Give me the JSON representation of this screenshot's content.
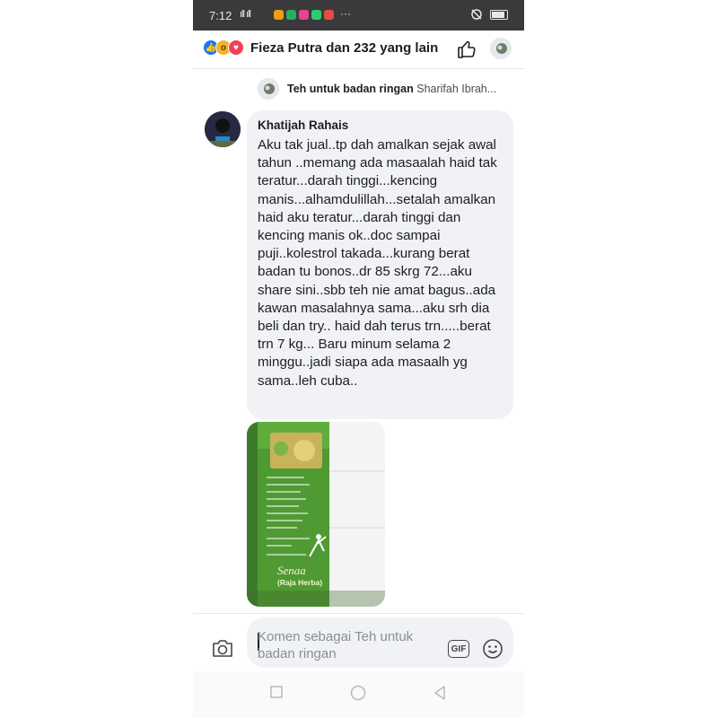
{
  "statusbar": {
    "time": "7:12",
    "signal": "⁴ᴳ᐀ıll",
    "dots": "···"
  },
  "header": {
    "reaction_names": "Fieza Putra dan 232 yang lain"
  },
  "reply_context": {
    "page_name": "Teh untuk badan ringan",
    "author_preview": "Sharifah Ibrah..."
  },
  "comment": {
    "author": "Khatijah Rahais",
    "text": "Aku tak jual..tp dah amalkan sejak awal tahun ..memang ada masaalah haid tak teratur...darah tinggi...kencing manis...alhamdulillah...setalah amalkan haid aku teratur...darah tinggi dan kencing manis ok..doc sampai puji..kolestrol takada...kurang berat badan tu bonos..dr 85 skrg 72...aku share sini..sbb teh nie amat bagus..ada kawan masalahnya sama...aku srh dia beli dan try..  haid dah terus trn.....berat trn 7 kg... Baru minum selama 2 minggu..jadi siapa ada masaalh yg sama..leh cuba.."
  },
  "photo": {
    "product_name": "Senaa",
    "product_sub": "(Raja Herba)"
  },
  "composer": {
    "placeholder": "Komen sebagai Teh untuk badan ringan",
    "gif_label": "GIF"
  },
  "colors": {
    "like_blue": "#1877f2",
    "love_red": "#f33e58",
    "wow_yellow": "#f7b125",
    "bubble_gray": "#f0f2f5",
    "status_dark": "#3a3a3c"
  },
  "icons": [
    "like-reaction-icon",
    "wow-reaction-icon",
    "love-reaction-icon",
    "thumbs-up-icon",
    "camera-icon",
    "gif-icon",
    "smiley-icon",
    "nav-recent-icon",
    "nav-home-icon",
    "nav-back-icon"
  ]
}
